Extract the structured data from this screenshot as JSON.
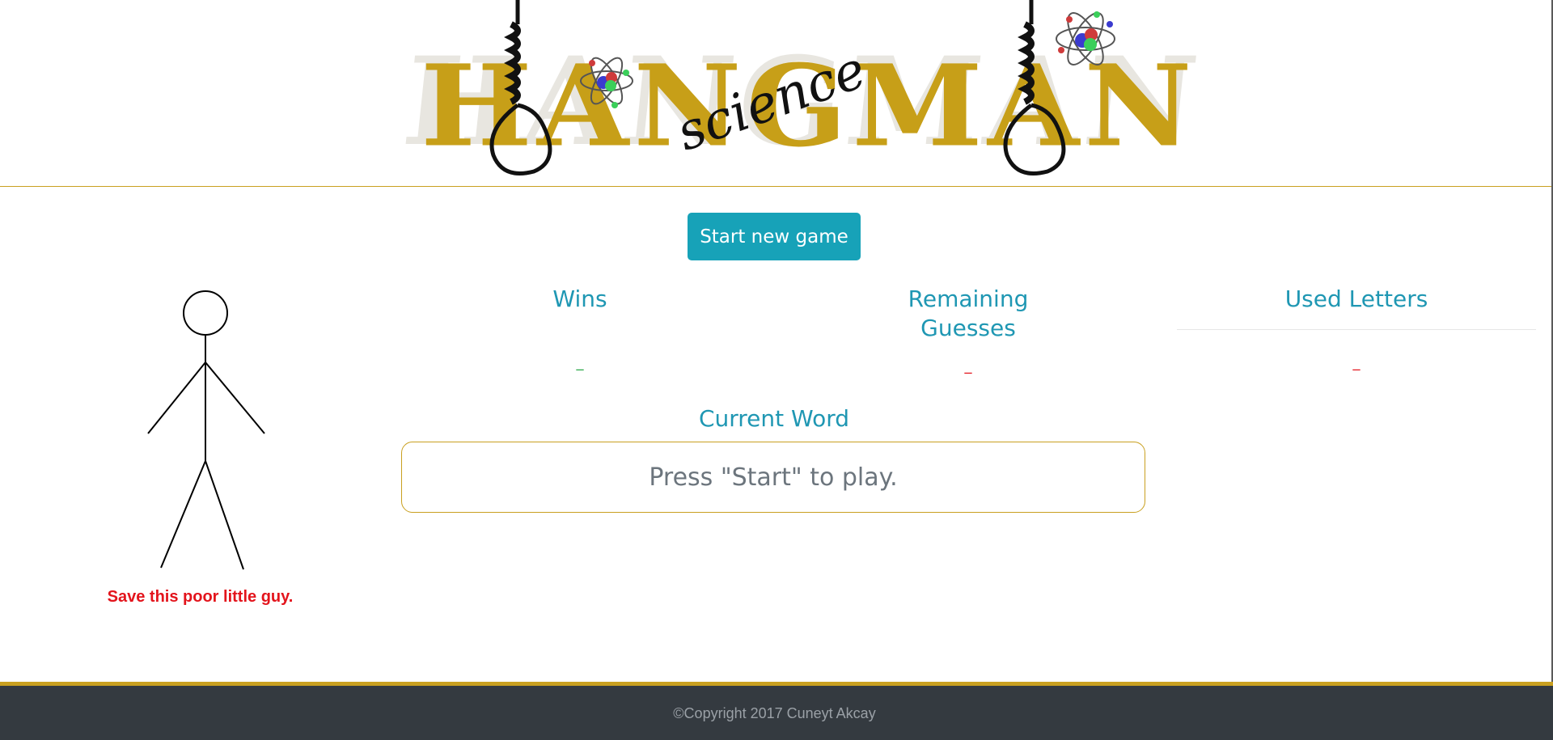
{
  "header": {
    "logo_title": "HANGMAN",
    "logo_subtitle": "science"
  },
  "controls": {
    "start_label": "Start new game"
  },
  "hangman": {
    "warning": "Save this poor little guy."
  },
  "stats": {
    "wins_label": "Wins",
    "wins_value": "_",
    "remaining_label": "Remaining Guesses",
    "remaining_value": "_",
    "used_label": "Used Letters",
    "used_value": "_"
  },
  "word": {
    "label": "Current Word",
    "value": "Press \"Start\" to play."
  },
  "footer": {
    "copyright": "©Copyright 2017 Cuneyt Akcay"
  },
  "colors": {
    "accent": "#17a2b8",
    "title": "#1f97b3",
    "gold": "#c9a020",
    "danger": "#e3141c",
    "success": "#28a745",
    "footer_bg": "#343a40"
  }
}
